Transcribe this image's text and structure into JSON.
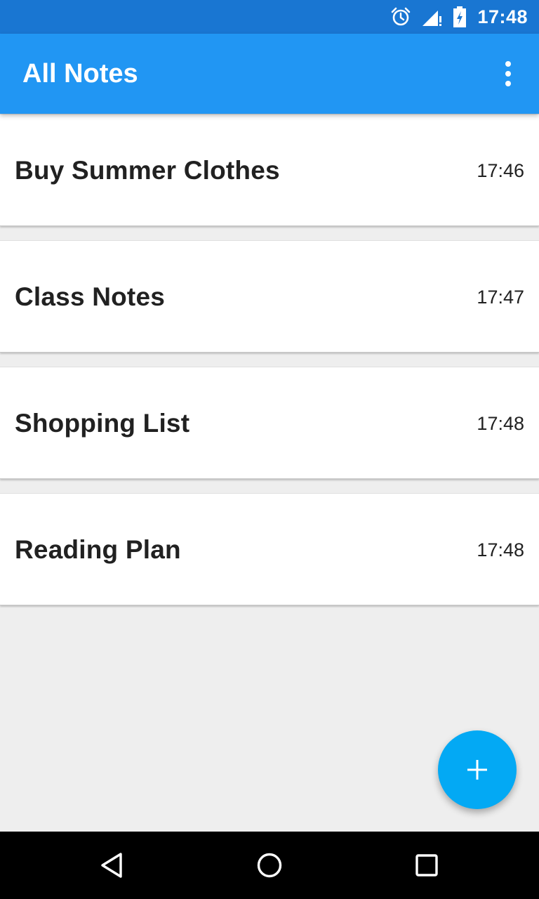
{
  "status_bar": {
    "time": "17:48",
    "icons": [
      "alarm-icon",
      "signal-icon",
      "battery-icon"
    ]
  },
  "app_bar": {
    "title": "All Notes",
    "menu_icon": "more-vert-icon"
  },
  "notes": [
    {
      "title": "Buy Summer Clothes",
      "time": "17:46"
    },
    {
      "title": "Class Notes",
      "time": "17:47"
    },
    {
      "title": "Shopping List",
      "time": "17:48"
    },
    {
      "title": "Reading Plan",
      "time": "17:48"
    }
  ],
  "fab": {
    "icon": "add-icon"
  },
  "nav_bar": {
    "icons": [
      "back-icon",
      "home-icon",
      "recents-icon"
    ]
  },
  "colors": {
    "status_bar": "#1976D2",
    "app_bar": "#2196F3",
    "fab": "#03A9F4",
    "background": "#EEEEEE"
  }
}
